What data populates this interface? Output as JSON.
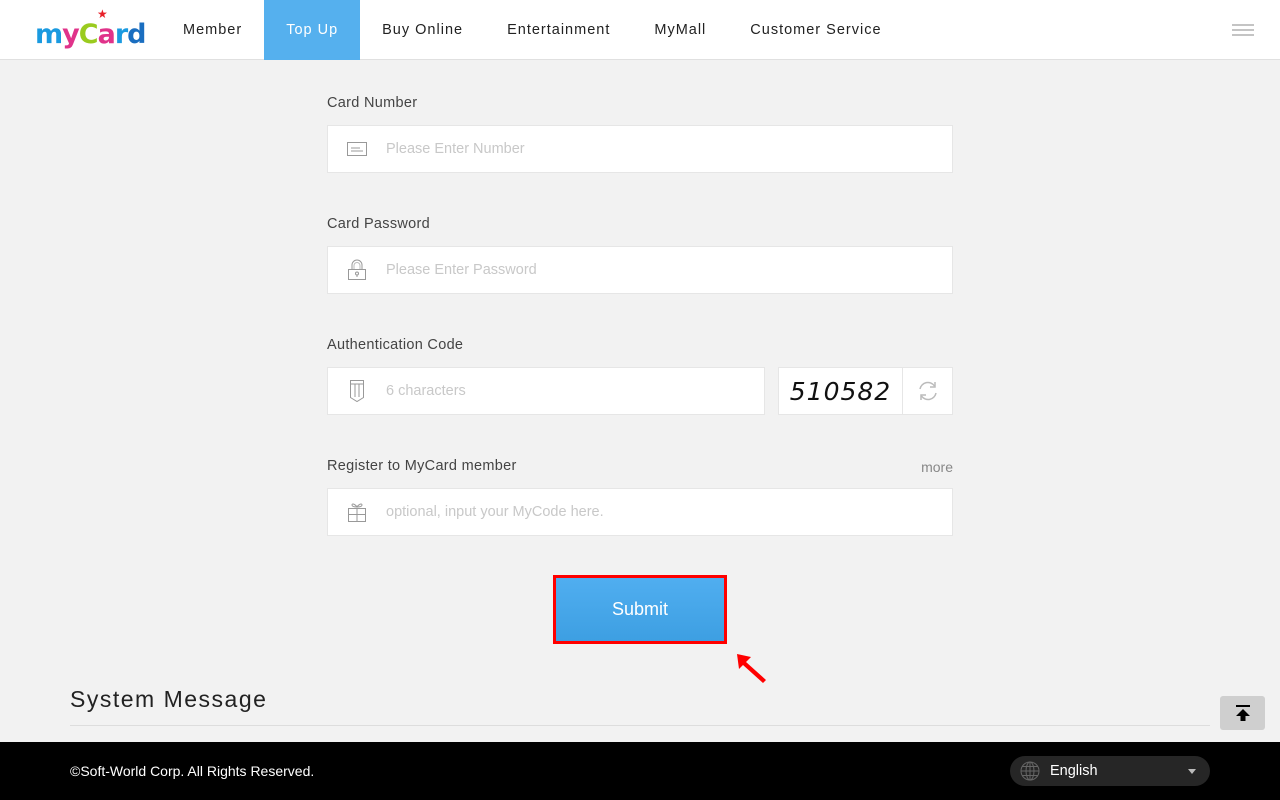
{
  "header": {
    "logo_text": {
      "m": "m",
      "y": "y",
      "c": "C",
      "a": "a",
      "r": "r",
      "d": "d"
    },
    "nav": [
      {
        "label": "Member",
        "active": false
      },
      {
        "label": "Top Up",
        "active": true
      },
      {
        "label": "Buy Online",
        "active": false
      },
      {
        "label": "Entertainment",
        "active": false
      },
      {
        "label": "MyMall",
        "active": false
      },
      {
        "label": "Customer Service",
        "active": false
      }
    ],
    "menu_icon": "hamburger-icon"
  },
  "form": {
    "card_number": {
      "label": "Card Number",
      "placeholder": "Please Enter Number",
      "value": "",
      "icon": "card-icon"
    },
    "card_password": {
      "label": "Card Password",
      "placeholder": "Please Enter Password",
      "value": "",
      "icon": "lock-icon"
    },
    "auth_code": {
      "label": "Authentication Code",
      "placeholder": "6 characters",
      "value": "",
      "icon": "pencil-icon",
      "captcha": "510582",
      "refresh_icon": "refresh-icon"
    },
    "register": {
      "label": "Register to MyCard member",
      "more": "more",
      "placeholder": "optional, input your MyCode here.",
      "value": "",
      "icon": "gift-icon"
    },
    "submit_label": "Submit"
  },
  "system_message": {
    "title": "System Message"
  },
  "back_to_top_icon": "arrow-up-to-top-icon",
  "footer": {
    "copyright": "©Soft-World Corp. All Rights Reserved.",
    "language": "English"
  },
  "colors": {
    "accent": "#55b0ee",
    "submit": "#45a6e8",
    "highlight": "#ff0000"
  }
}
